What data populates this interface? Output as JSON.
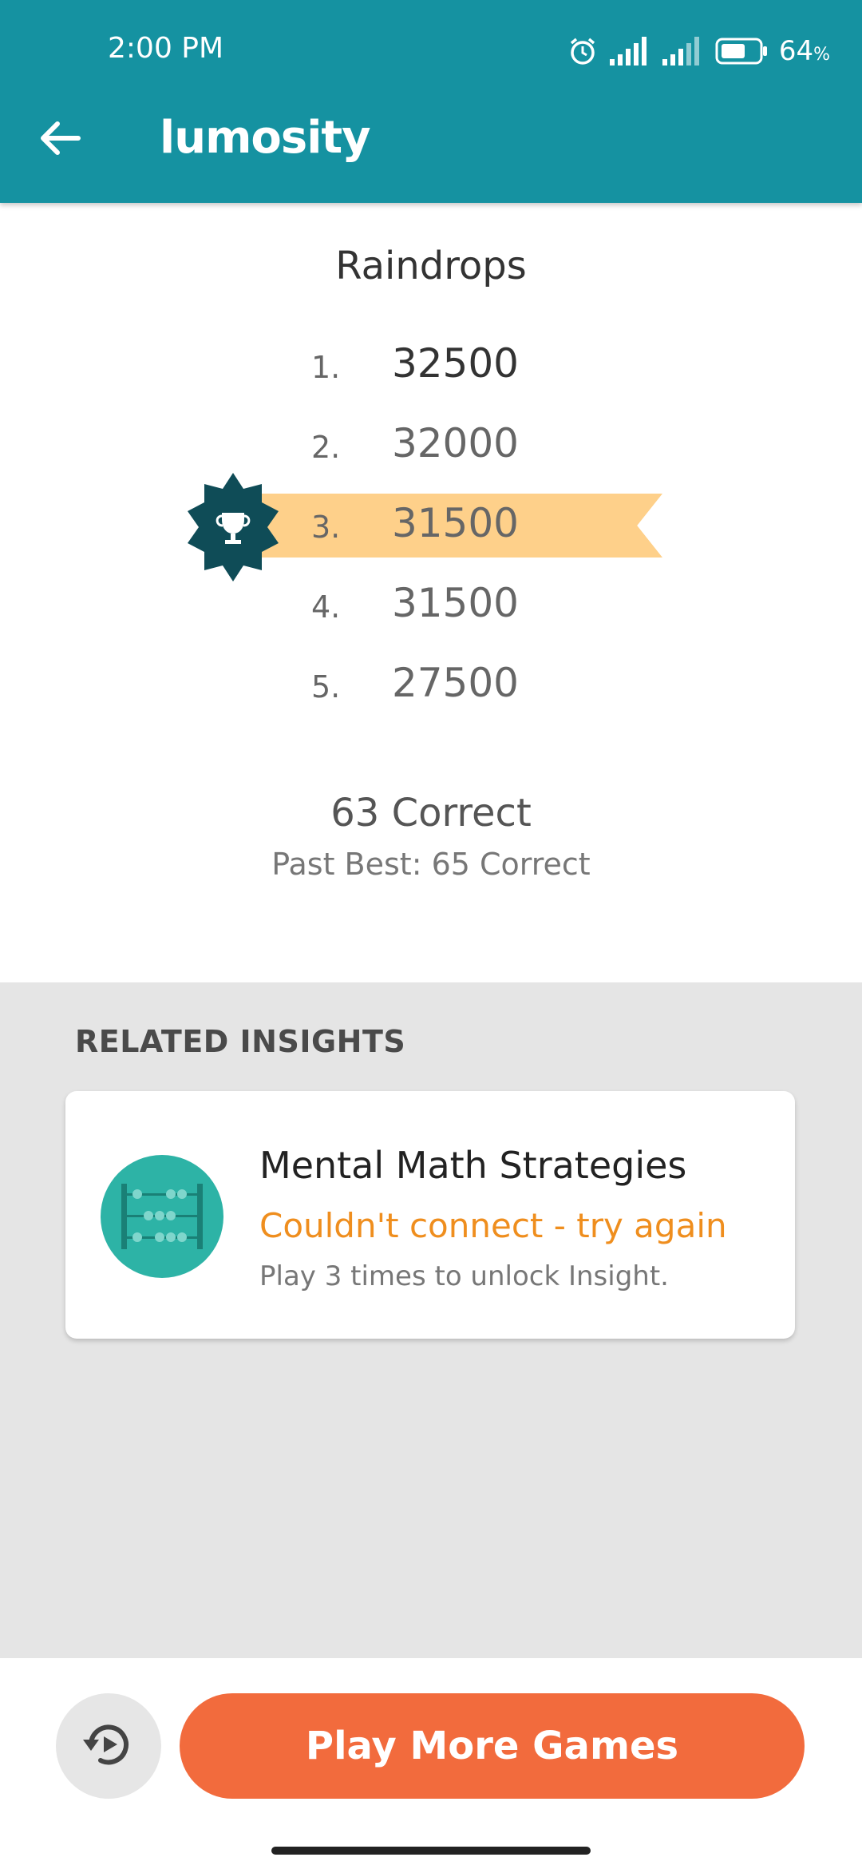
{
  "status_bar": {
    "time": "2:00 PM",
    "battery_percent": "64",
    "battery_unit": "%",
    "icons": [
      "alarm-icon",
      "signal-icon",
      "signal-icon",
      "battery-icon"
    ]
  },
  "app_bar": {
    "title": "lumosity",
    "back_icon": "arrow-left-icon",
    "color": "#1592a1"
  },
  "game": {
    "title": "Raindrops",
    "scores": [
      {
        "rank": "1.",
        "score": "32500"
      },
      {
        "rank": "2.",
        "score": "32000"
      },
      {
        "rank": "3.",
        "score": "31500",
        "highlighted": true
      },
      {
        "rank": "4.",
        "score": "31500"
      },
      {
        "rank": "5.",
        "score": "27500"
      }
    ],
    "highlight_color": "#fed08a",
    "badge_icon": "trophy-icon",
    "badge_color": "#0f4c57",
    "result": "63 Correct",
    "past_best": "Past Best: 65 Correct"
  },
  "insights": {
    "header": "RELATED INSIGHTS",
    "card": {
      "icon": "abacus-icon",
      "title": "Mental Math Strategies",
      "status": "Couldn't connect - try again",
      "subtitle": "Play 3 times to unlock Insight.",
      "status_color": "#ef8e1e"
    }
  },
  "bottom_bar": {
    "replay_icon": "replay-icon",
    "play_button": "Play More Games",
    "play_color": "#f26b3d"
  }
}
